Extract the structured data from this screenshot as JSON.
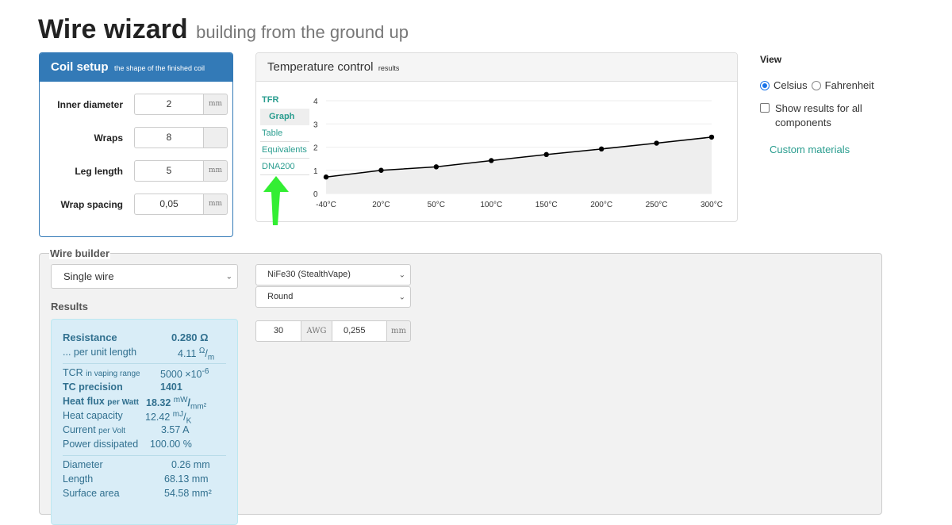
{
  "title": {
    "main": "Wire wizard",
    "sub": "building from the ground up"
  },
  "coil_setup": {
    "heading": "Coil setup",
    "subheading": "the shape of the finished coil",
    "fields": [
      {
        "label": "Inner diameter",
        "value": "2",
        "unit": "mm"
      },
      {
        "label": "Wraps",
        "value": "8",
        "unit": ""
      },
      {
        "label": "Leg length",
        "value": "5",
        "unit": "mm"
      },
      {
        "label": "Wrap spacing",
        "value": "0,05",
        "unit": "mm"
      }
    ]
  },
  "temperature": {
    "heading": "Temperature control",
    "subheading": "results",
    "tabs": [
      "TFR",
      "Graph",
      "Table",
      "Equivalents",
      "DNA200"
    ],
    "active_tab": "Graph"
  },
  "chart_data": {
    "type": "line",
    "categories": [
      "-40°C",
      "20°C",
      "50°C",
      "100°C",
      "150°C",
      "200°C",
      "250°C",
      "300°C"
    ],
    "values": [
      0.71,
      1.0,
      1.15,
      1.42,
      1.68,
      1.92,
      2.17,
      2.43
    ],
    "y_ticks": [
      "0",
      "1",
      "2",
      "3",
      "4"
    ],
    "ylim": [
      0,
      4
    ],
    "grid": true,
    "line_color": "#000000",
    "area_color": "#eeeeee"
  },
  "annotation_arrow": {
    "color": "#33ee33",
    "icon": "arrow-up-icon"
  },
  "view": {
    "heading": "View",
    "celsius_label": "Celsius",
    "fahrenheit_label": "Fahrenheit",
    "selected_unit": "Celsius",
    "show_all_label": "Show results for all components",
    "show_all_checked": false,
    "custom_materials_label": "Custom materials"
  },
  "wire_builder": {
    "legend": "Wire builder",
    "type_select": "Single wire",
    "results_heading": "Results",
    "material_select": "NiFe30 (StealthVape)",
    "shape_select": "Round",
    "gauge": "30",
    "gauge_unit": "AWG",
    "diameter": "0,255",
    "diameter_unit": "mm"
  },
  "results": {
    "resistance": {
      "label": "Resistance",
      "value": "0.280 Ω"
    },
    "per_length": {
      "label": "... per unit length",
      "value": "4.11",
      "unit_num": "Ω",
      "unit_den": "m"
    },
    "tcr": {
      "label": "TCR",
      "label_small": "in vaping range",
      "value": "5000 ×10",
      "exp": "-6"
    },
    "tc_precision": {
      "label": "TC precision",
      "value": "1401"
    },
    "heat_flux": {
      "label": "Heat flux",
      "label_small": "per Watt",
      "value": "18.32",
      "unit_num": "mW",
      "unit_den": "mm²"
    },
    "heat_capacity": {
      "label": "Heat capacity",
      "value": "12.42",
      "unit_num": "mJ",
      "unit_den": "K"
    },
    "current": {
      "label": "Current",
      "label_small": "per Volt",
      "value": "3.57 A"
    },
    "power": {
      "label": "Power dissipated",
      "value": "100.00 %"
    },
    "diameter": {
      "label": "Diameter",
      "value": "0.26 mm"
    },
    "length": {
      "label": "Length",
      "value": "68.13 mm"
    },
    "surface": {
      "label": "Surface area",
      "value": "54.58 mm²"
    }
  }
}
